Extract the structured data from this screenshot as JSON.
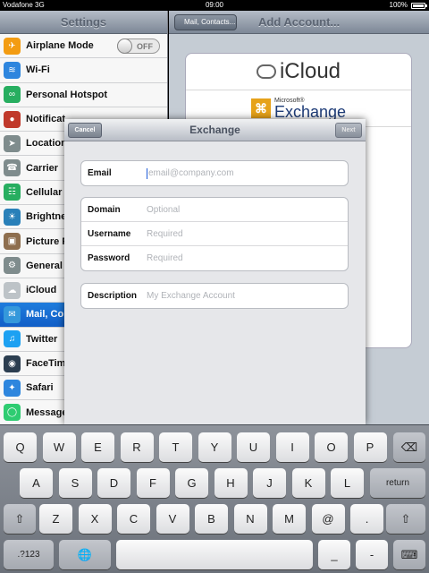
{
  "status": {
    "carrier": "Vodafone 3G",
    "time": "09:00",
    "battery": "100%"
  },
  "master": {
    "title": "Settings",
    "items": [
      {
        "label": "Airplane Mode",
        "icon": "airplane-icon",
        "color": "#f39c12",
        "glyph": "✈"
      },
      {
        "label": "Wi-Fi",
        "icon": "wifi-icon",
        "color": "#2e86de",
        "glyph": "≋"
      },
      {
        "label": "Personal Hotspot",
        "icon": "hotspot-icon",
        "color": "#27ae60",
        "glyph": "∞"
      },
      {
        "label": "Notificat",
        "icon": "notifications-icon",
        "color": "#c0392b",
        "glyph": "●"
      },
      {
        "label": "Location",
        "icon": "location-icon",
        "color": "#7f8c8d",
        "glyph": "➤"
      },
      {
        "label": "Carrier",
        "icon": "carrier-icon",
        "color": "#7f8c8d",
        "glyph": "☎"
      },
      {
        "label": "Cellular",
        "icon": "cellular-icon",
        "color": "#27ae60",
        "glyph": "☷"
      },
      {
        "label": "Brightne",
        "icon": "brightness-icon",
        "color": "#2980b9",
        "glyph": "☀"
      },
      {
        "label": "Picture F",
        "icon": "picture-frame-icon",
        "color": "#8e6e4e",
        "glyph": "▣"
      },
      {
        "label": "General",
        "icon": "gear-icon",
        "color": "#7f8c8d",
        "glyph": "⚙"
      },
      {
        "label": "iCloud",
        "icon": "icloud-icon",
        "color": "#bdc3c7",
        "glyph": "☁"
      },
      {
        "label": "Mail, Co",
        "icon": "mail-icon",
        "color": "#3498db",
        "glyph": "✉"
      },
      {
        "label": "Twitter",
        "icon": "twitter-icon",
        "color": "#1da1f2",
        "glyph": "♫"
      },
      {
        "label": "FaceTim",
        "icon": "facetime-icon",
        "color": "#2c3e50",
        "glyph": "◉"
      },
      {
        "label": "Safari",
        "icon": "safari-icon",
        "color": "#2e86de",
        "glyph": "✦"
      },
      {
        "label": "Message",
        "icon": "messages-icon",
        "color": "#2ecc71",
        "glyph": "◯"
      }
    ],
    "airplane_toggle": "OFF"
  },
  "detail": {
    "back": "Mail, Contacts...",
    "title": "Add Account..."
  },
  "providers": {
    "icloud": "iCloud",
    "ms_small": "Microsoft®",
    "exchange": "Exchange"
  },
  "modal": {
    "title": "Exchange",
    "cancel": "Cancel",
    "next": "Next",
    "email_label": "Email",
    "email_placeholder": "email@company.com",
    "domain_label": "Domain",
    "domain_placeholder": "Optional",
    "username_label": "Username",
    "username_placeholder": "Required",
    "password_label": "Password",
    "password_placeholder": "Required",
    "description_label": "Description",
    "description_placeholder": "My Exchange Account"
  },
  "keyboard": {
    "row1": [
      "Q",
      "W",
      "E",
      "R",
      "T",
      "Y",
      "U",
      "I",
      "O",
      "P"
    ],
    "row2": [
      "A",
      "S",
      "D",
      "F",
      "G",
      "H",
      "J",
      "K",
      "L"
    ],
    "row3": [
      "Z",
      "X",
      "C",
      "V",
      "B",
      "N",
      "M",
      "@",
      "."
    ],
    "backspace": "⌫",
    "return": "return",
    "shift": "⇧",
    "numbers": ".?123",
    "globe": "🌐",
    "underscore": "_",
    "dash": "-",
    "hide": "⌨"
  }
}
